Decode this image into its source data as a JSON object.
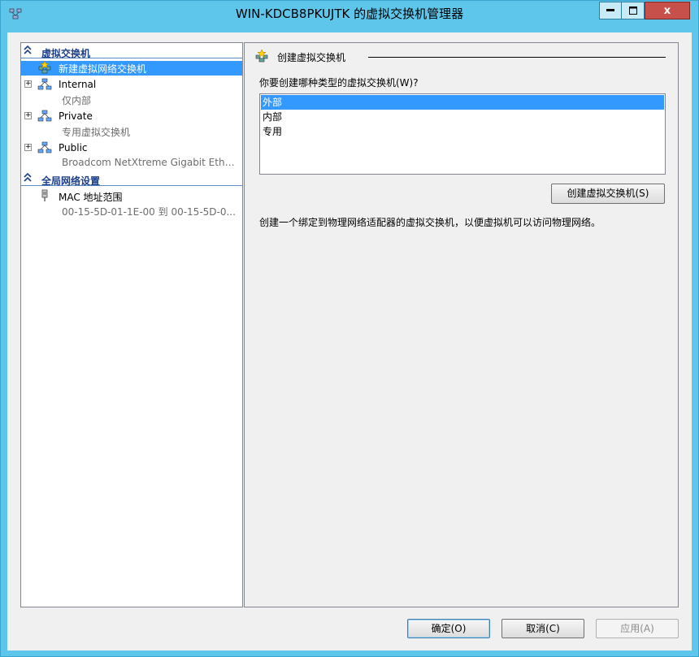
{
  "window": {
    "title": "WIN-KDCB8PKUJTK 的虚拟交换机管理器",
    "minimize_symbol": "▬",
    "maximize_symbol": "☐",
    "close_symbol": "x"
  },
  "left_pane": {
    "section1": {
      "chevron": "≈",
      "label": "虚拟交换机"
    },
    "new_switch": {
      "label": "新建虚拟网络交换机"
    },
    "switches": [
      {
        "expander": "+",
        "name": "Internal",
        "sub": "仅内部"
      },
      {
        "expander": "+",
        "name": "Private",
        "sub": "专用虚拟交换机"
      },
      {
        "expander": "+",
        "name": "Public",
        "sub": "Broadcom NetXtreme Gigabit Ether..."
      }
    ],
    "section2": {
      "chevron": "≈",
      "label": "全局网络设置"
    },
    "mac_range": {
      "name": "MAC 地址范围",
      "sub": "00-15-5D-01-1E-00 到 00-15-5D-0..."
    }
  },
  "right_pane": {
    "group_title": "创建虚拟交换机",
    "question": "你要创建哪种类型的虚拟交换机(W)?",
    "options": [
      "外部",
      "内部",
      "专用"
    ],
    "selected_option": "外部",
    "create_button": "创建虚拟交换机(S)",
    "description": "创建一个绑定到物理网络适配器的虚拟交换机，以便虚拟机可以访问物理网络。"
  },
  "buttons": {
    "ok": "确定(O)",
    "cancel": "取消(C)",
    "apply": "应用(A)"
  },
  "icons": {
    "app": "switch-manager-icon",
    "new_switch": "new-switch-star-icon",
    "network": "network-nodes-icon",
    "mac": "network-adapter-plug-icon"
  },
  "colors": {
    "titlebar": "#5ec6ea",
    "selection": "#3399ff",
    "section_header": "#1d3f8a",
    "close_button": "#c7504a"
  }
}
